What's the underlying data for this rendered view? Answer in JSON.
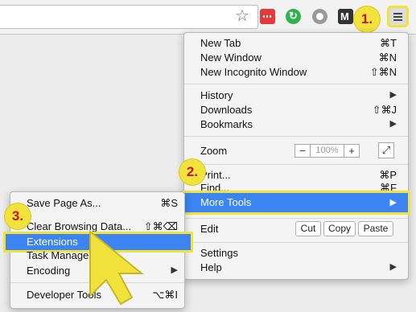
{
  "toolbar": {
    "star_icon": "star-icon",
    "extensions": [
      "ext-red-icon",
      "ext-green-refresh-icon",
      "ext-compass-icon",
      "ext-m-icon"
    ],
    "menu_icon": "hamburger-menu-icon"
  },
  "callouts": {
    "one": "1.",
    "two": "2.",
    "three": "3."
  },
  "main_menu": {
    "new_tab": {
      "label": "New Tab",
      "shortcut": "⌘T"
    },
    "new_window": {
      "label": "New Window",
      "shortcut": "⌘N"
    },
    "new_incognito": {
      "label": "New Incognito Window",
      "shortcut": "⇧⌘N"
    },
    "history": {
      "label": "History"
    },
    "downloads": {
      "label": "Downloads",
      "shortcut": "⇧⌘J"
    },
    "bookmarks": {
      "label": "Bookmarks"
    },
    "zoom": {
      "label": "Zoom",
      "minus": "−",
      "value": "100%",
      "plus": "+"
    },
    "print": {
      "label": "Print...",
      "shortcut": "⌘P"
    },
    "find": {
      "label": "Find...",
      "shortcut": "⌘F"
    },
    "more_tools": {
      "label": "More Tools"
    },
    "edit": {
      "label": "Edit",
      "cut": "Cut",
      "copy": "Copy",
      "paste": "Paste"
    },
    "settings": {
      "label": "Settings"
    },
    "help": {
      "label": "Help"
    }
  },
  "sub_menu": {
    "save_page": {
      "label": "Save Page As...",
      "shortcut": "⌘S"
    },
    "clear_browsing": {
      "label": "Clear Browsing Data...",
      "shortcut": "⇧⌘⌫"
    },
    "extensions": {
      "label": "Extensions"
    },
    "task_manager": {
      "label": "Task Manager"
    },
    "encoding": {
      "label": "Encoding"
    },
    "developer_tools": {
      "label": "Developer Tools",
      "shortcut": "⌥⌘I"
    }
  },
  "colors": {
    "highlight": "#3b84f2",
    "callout": "#f1e23c",
    "callout_text": "#c0191c"
  }
}
